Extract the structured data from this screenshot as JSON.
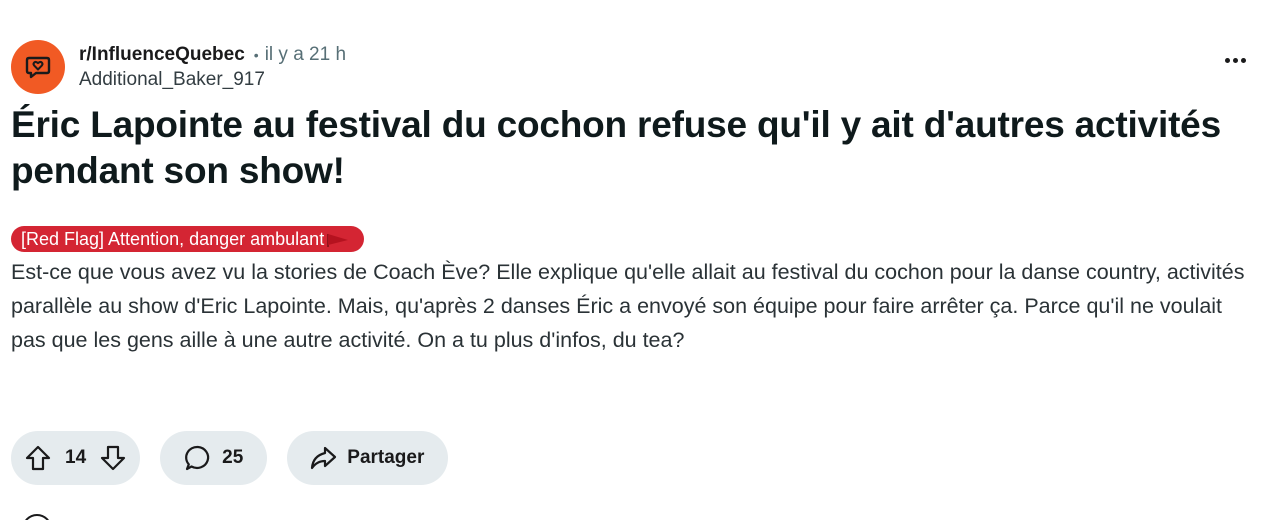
{
  "post": {
    "subreddit": "r/InfluenceQuebec",
    "separator": "•",
    "time": "il y a 21 h",
    "author": "Additional_Baker_917",
    "title": "Éric Lapointe au festival du cochon refuse qu'il y ait d'autres activités pendant son show!",
    "flair": "[Red Flag] Attention, danger ambulant",
    "flair_color": "#d42533",
    "body": "Est-ce que vous avez vu la stories de Coach Ève? Elle explique qu'elle allait au festival du cochon pour la danse country, activités parallèle au show d'Eric Lapointe. Mais, qu'après 2 danses Éric a envoyé son équipe pour faire arrêter ça. Parce qu'il ne voulait pas que les gens aille à une autre activité. On a tu plus d'infos, du tea?"
  },
  "icons": {
    "avatar": "subreddit-chat-icon",
    "more": "more-options-icon",
    "upvote": "upvote-icon",
    "downvote": "downvote-icon",
    "comment": "comment-icon",
    "share": "share-icon",
    "flair_emoji": "red-flag-icon"
  },
  "actions": {
    "votes": "14",
    "comments": "25",
    "share_label": "Partager"
  },
  "colors": {
    "avatar_bg": "#f15a24",
    "pill_bg": "#e5ebee"
  }
}
